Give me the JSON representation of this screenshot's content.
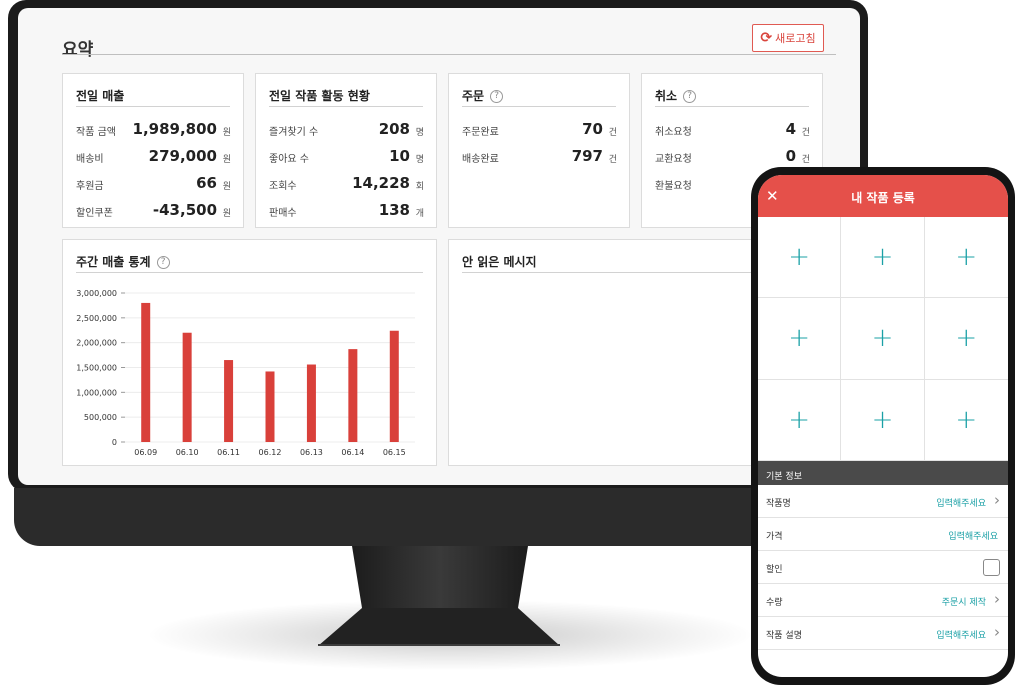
{
  "dashboard": {
    "section_title": "요약",
    "refresh_label": "새로고침",
    "refresh_icon": "refresh-icon",
    "cards": {
      "sales": {
        "title": "전일 매출",
        "rows": [
          {
            "label": "작품 금액",
            "value": "1,989,800",
            "unit": "원"
          },
          {
            "label": "배송비",
            "value": "279,000",
            "unit": "원"
          },
          {
            "label": "후원금",
            "value": "66",
            "unit": "원"
          },
          {
            "label": "할인쿠폰",
            "value": "-43,500",
            "unit": "원"
          }
        ]
      },
      "activity": {
        "title": "전일 작품 활동 현황",
        "rows": [
          {
            "label": "즐겨찾기 수",
            "value": "208",
            "unit": "명"
          },
          {
            "label": "좋아요 수",
            "value": "10",
            "unit": "명"
          },
          {
            "label": "조회수",
            "value": "14,228",
            "unit": "회"
          },
          {
            "label": "판매수",
            "value": "138",
            "unit": "개"
          }
        ]
      },
      "orders": {
        "title": "주문",
        "rows": [
          {
            "label": "주문완료",
            "value": "70",
            "unit": "건"
          },
          {
            "label": "배송완료",
            "value": "797",
            "unit": "건"
          }
        ]
      },
      "cancel": {
        "title": "취소",
        "rows": [
          {
            "label": "취소요청",
            "value": "4",
            "unit": "건"
          },
          {
            "label": "교환요청",
            "value": "0",
            "unit": "건"
          },
          {
            "label": "환불요청",
            "value": "",
            "unit": ""
          }
        ]
      },
      "weekly": {
        "title": "주간 매출 통계"
      },
      "messages": {
        "title": "안 읽은 메시지"
      }
    },
    "help_glyph": "?"
  },
  "chart_data": {
    "type": "bar",
    "categories": [
      "06.09",
      "06.10",
      "06.11",
      "06.12",
      "06.13",
      "06.14",
      "06.15"
    ],
    "values": [
      2800000,
      2200000,
      1650000,
      1420000,
      1560000,
      1870000,
      2240000
    ],
    "ytick_labels": [
      "0",
      "500,000",
      "1,000,000",
      "1,500,000",
      "2,000,000",
      "2,500,000",
      "3,000,000"
    ],
    "ylim": [
      0,
      3000000
    ],
    "bar_color": "#d9403a",
    "grid": true,
    "legend": false
  },
  "phone": {
    "title": "내 작품 등록",
    "close_glyph": "✕",
    "add_glyph": "+",
    "photo_slots": 9,
    "info_header": "기본 정보",
    "form": [
      {
        "label": "작품명",
        "value": "입력해주세요",
        "chevron": true
      },
      {
        "label": "가격",
        "value": "입력해주세요",
        "chevron": false
      },
      {
        "label": "할인",
        "value": "",
        "checkbox": true
      },
      {
        "label": "수량",
        "value": "주문시 제작",
        "chevron": true
      },
      {
        "label": "작품 설명",
        "value": "입력해주세요",
        "chevron": true
      }
    ],
    "accent_color": "#e5504a",
    "link_color": "#1aa0a6"
  }
}
